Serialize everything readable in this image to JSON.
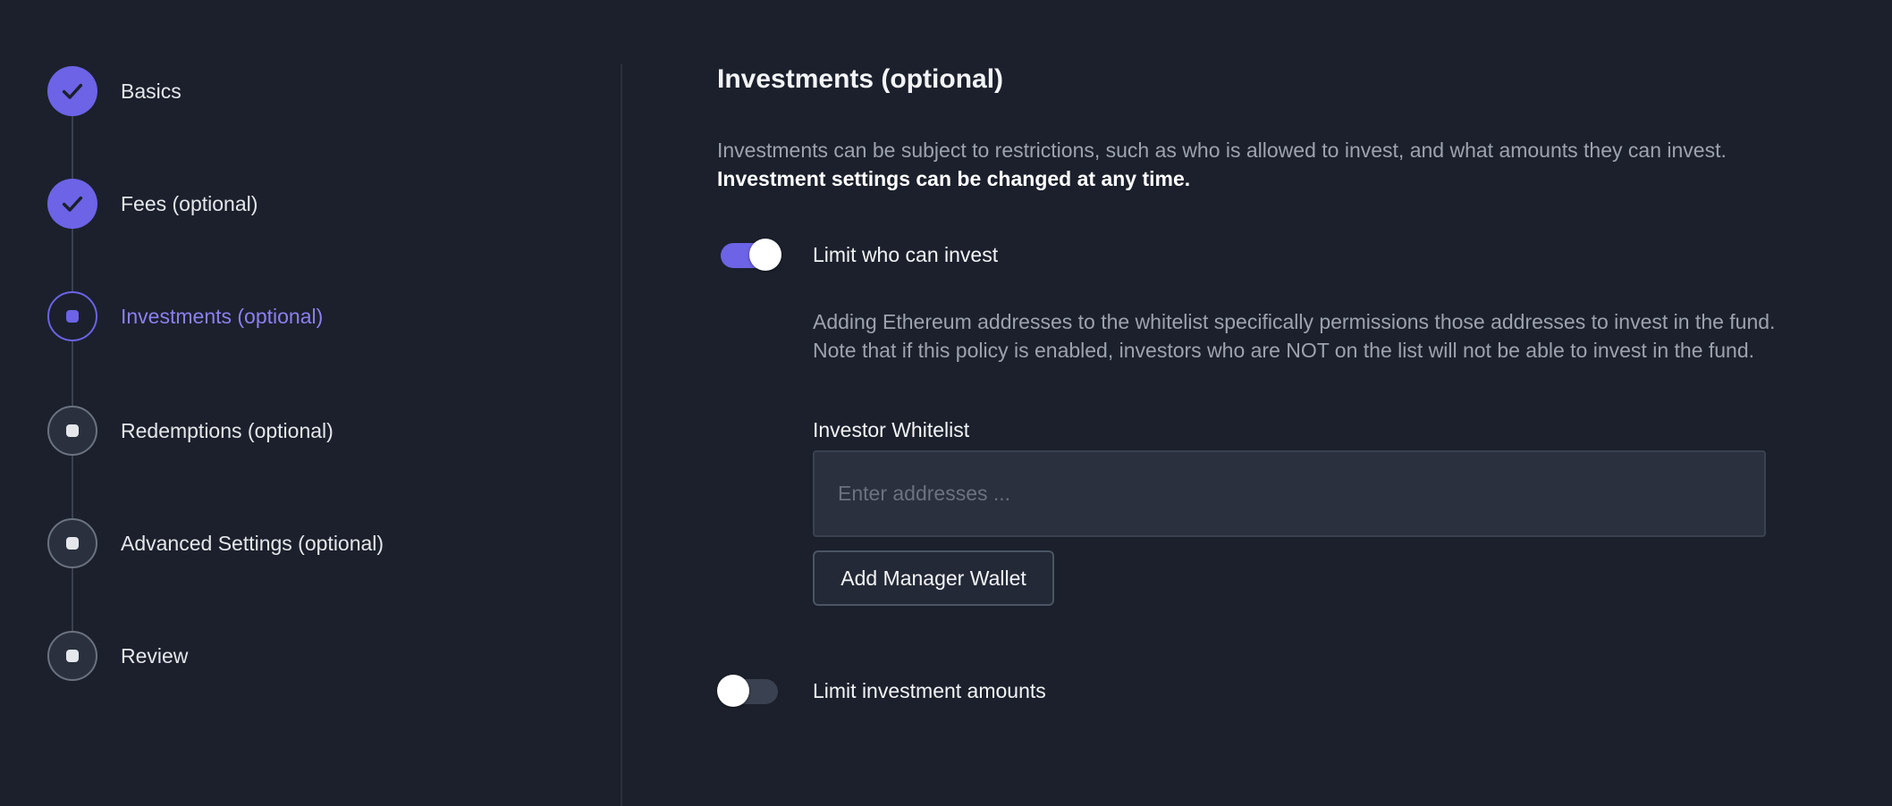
{
  "stepper": {
    "steps": [
      {
        "label": "Basics",
        "state": "done"
      },
      {
        "label": "Fees (optional)",
        "state": "done"
      },
      {
        "label": "Investments (optional)",
        "state": "current"
      },
      {
        "label": "Redemptions (optional)",
        "state": "upcoming"
      },
      {
        "label": "Advanced Settings (optional)",
        "state": "upcoming"
      },
      {
        "label": "Review",
        "state": "upcoming"
      }
    ]
  },
  "main": {
    "title": "Investments (optional)",
    "description": "Investments can be subject to restrictions, such as who is allowed to invest, and what amounts they can invest.",
    "description_bold": "Investment settings can be changed at any time.",
    "limit_who": {
      "label": "Limit who can invest",
      "enabled": true,
      "description": "Adding Ethereum addresses to the whitelist specifically permissions those addresses to invest in the fund. Note that if this policy is enabled, investors who are NOT on the list will not be able to invest in the fund.",
      "whitelist_label": "Investor Whitelist",
      "whitelist_placeholder": "Enter addresses ...",
      "whitelist_value": "",
      "add_wallet_button": "Add Manager Wallet"
    },
    "limit_amounts": {
      "label": "Limit investment amounts",
      "enabled": false
    }
  },
  "colors": {
    "background": "#1b202c",
    "accent": "#6c63e6",
    "accent_text": "#8b80f0",
    "muted_text": "#9ca3af"
  }
}
